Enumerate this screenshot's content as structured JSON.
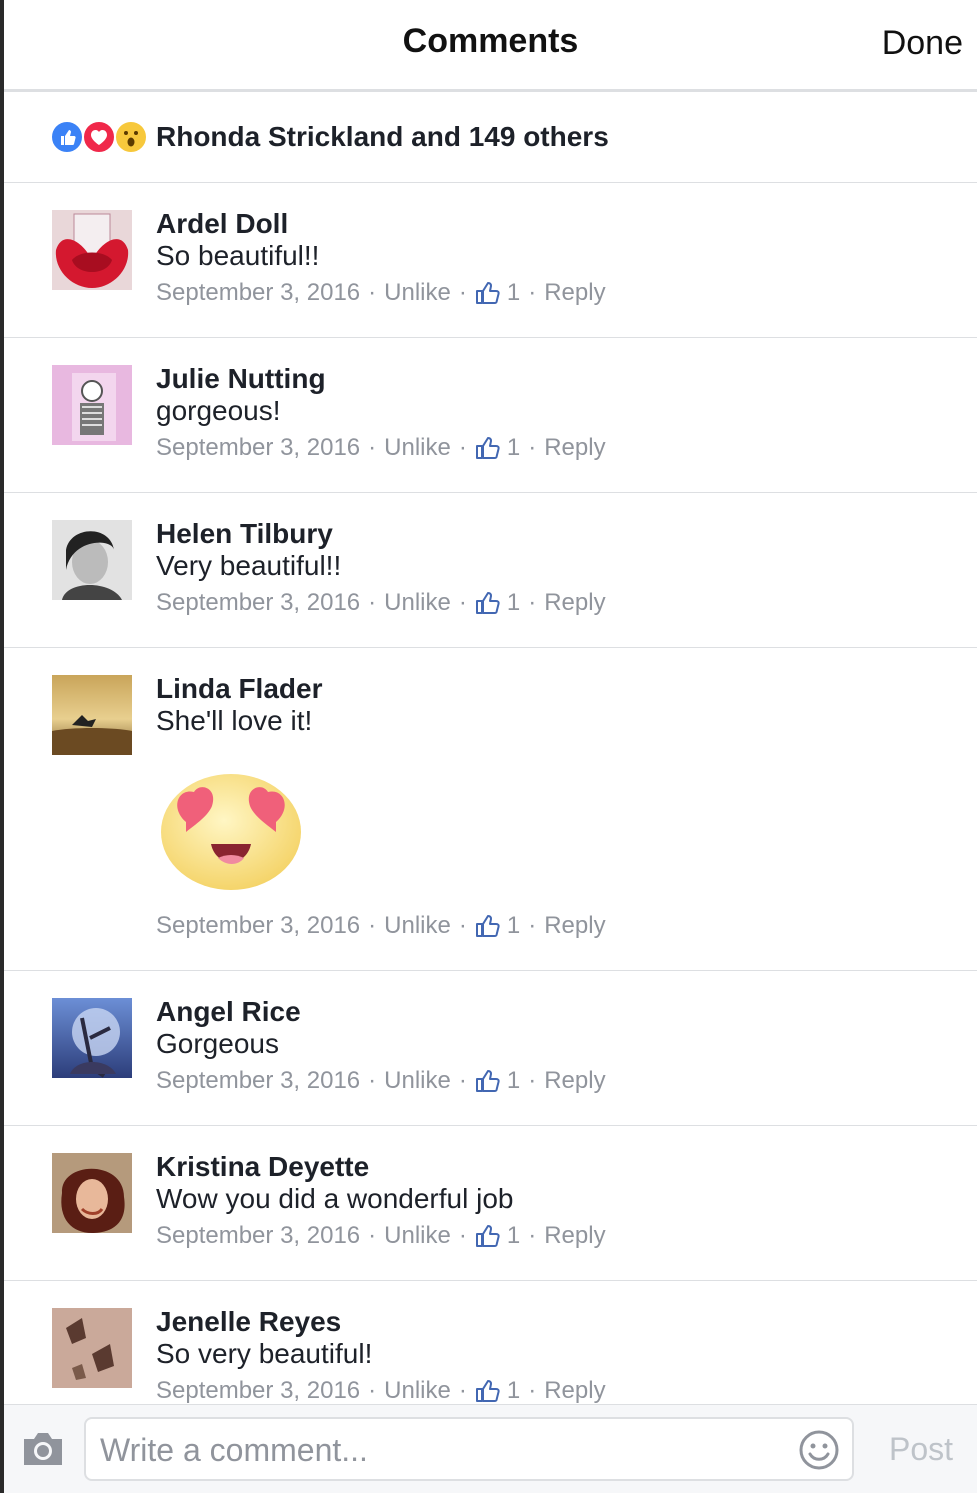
{
  "header": {
    "title": "Comments",
    "done_label": "Done"
  },
  "reactions": {
    "summary": "Rhonda Strickland and 149 others",
    "icons": [
      "like-icon",
      "love-icon",
      "wow-icon"
    ]
  },
  "comments": [
    {
      "name": "Ardel Doll",
      "text": "So beautiful!!",
      "date": "September 3, 2016",
      "unlike": "Unlike",
      "likes": "1",
      "reply": "Reply"
    },
    {
      "name": "Julie Nutting",
      "text": "gorgeous!",
      "date": "September 3, 2016",
      "unlike": "Unlike",
      "likes": "1",
      "reply": "Reply"
    },
    {
      "name": "Helen Tilbury",
      "text": "Very beautiful!!",
      "date": "September 3, 2016",
      "unlike": "Unlike",
      "likes": "1",
      "reply": "Reply"
    },
    {
      "name": "Linda Flader",
      "text": "She'll love it!",
      "date": "September 3, 2016",
      "unlike": "Unlike",
      "likes": "1",
      "reply": "Reply"
    },
    {
      "name": "Angel Rice",
      "text": "Gorgeous",
      "date": "September 3, 2016",
      "unlike": "Unlike",
      "likes": "1",
      "reply": "Reply"
    },
    {
      "name": "Kristina Deyette",
      "text": "Wow you did a wonderful job",
      "date": "September 3, 2016",
      "unlike": "Unlike",
      "likes": "1",
      "reply": "Reply"
    },
    {
      "name": "Jenelle Reyes",
      "text": "So very beautiful!",
      "date": "September 3, 2016",
      "unlike": "Unlike",
      "likes": "1",
      "reply": "Reply"
    }
  ],
  "composer": {
    "placeholder": "Write a comment...",
    "post_label": "Post"
  },
  "colors": {
    "accent_blue": "#4267b2",
    "meta_gray": "#90949c",
    "love_red": "#f0284a"
  }
}
